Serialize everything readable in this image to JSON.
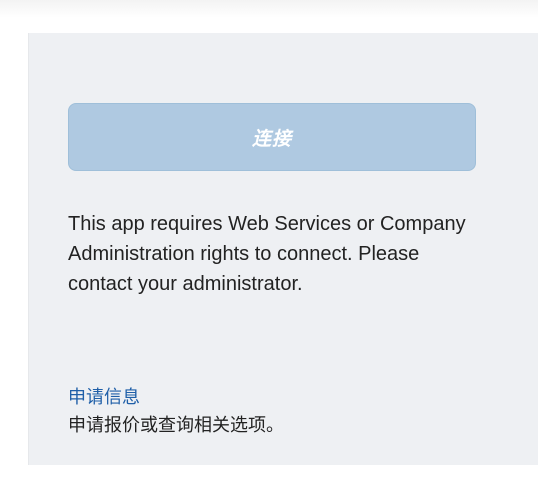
{
  "connect_panel": {
    "button_label": "连接",
    "message": "This app requires Web Services or Company Administration rights to connect. Please contact your administrator.",
    "info_link": "申请信息",
    "info_description": "申请报价或查询相关选项。"
  }
}
